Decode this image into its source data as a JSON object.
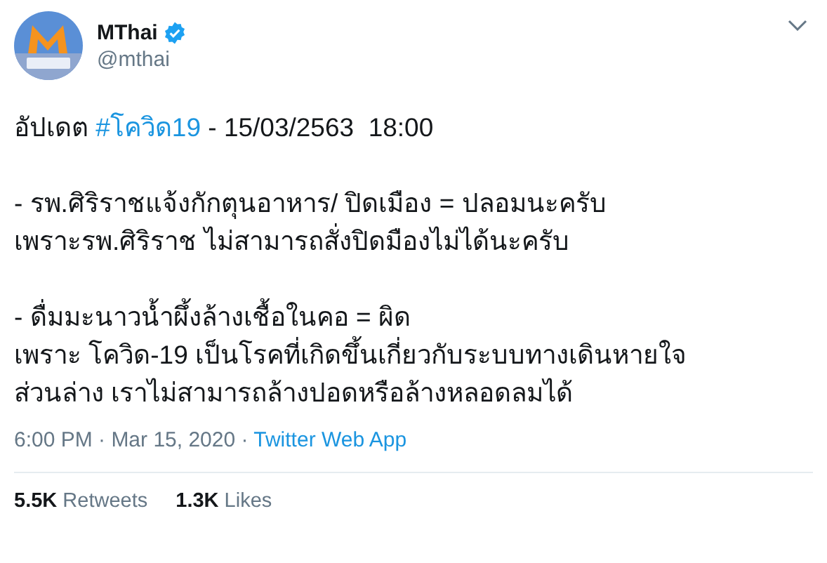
{
  "author": {
    "name": "MThai",
    "verified": true,
    "handle": "@mthai"
  },
  "headline": {
    "before": "อัปเดต ",
    "hashtag": "#โควิด19",
    "after": " - 15/03/2563  18:00"
  },
  "paragraphs": [
    [
      "- รพ.ศิริราชแจ้งกักตุนอาหาร/ ปิดเมือง = ปลอมนะครับ",
      "เพราะรพ.ศิริราช ไม่สามารถสั่งปิดมืองไม่ได้นะครับ"
    ],
    [
      "- ดื่มมะนาวน้ำผึ้งล้างเชื้อในคอ = ผิด",
      "เพราะ โควิด-19 เป็นโรคที่เกิดขึ้นเกี่ยวกับระบบทางเดินหายใจ",
      "ส่วนล่าง เราไม่สามารถล้างปอดหรือล้างหลอดลมได้"
    ]
  ],
  "meta": {
    "time": "6:00 PM · Mar 15, 2020 · ",
    "source": "Twitter Web App"
  },
  "stats": [
    "**5.5K** Retweets",
    "**1.3K** Likes"
  ]
}
